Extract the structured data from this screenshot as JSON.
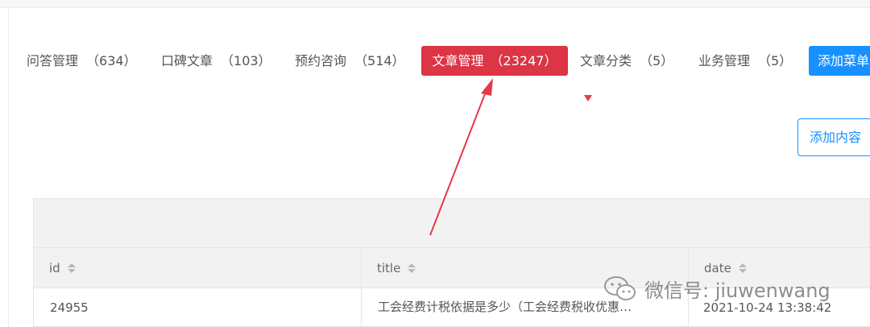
{
  "tabs": [
    {
      "label": "问答管理",
      "count": "（634）"
    },
    {
      "label": "口碑文章",
      "count": "（103）"
    },
    {
      "label": "预约咨询",
      "count": "（514）"
    },
    {
      "label": "文章管理",
      "count": "（23247）"
    },
    {
      "label": "文章分类",
      "count": "（5）"
    },
    {
      "label": "业务管理",
      "count": "（5）"
    },
    {
      "label": "添加菜单",
      "count": ""
    }
  ],
  "add_content_button": "添加内容",
  "table": {
    "columns": [
      "id",
      "title",
      "date"
    ],
    "rows": [
      {
        "id": "24955",
        "title": "工会经费计税依据是多少（工会经费税收优惠…",
        "date": "2021-10-24 13:38:42"
      }
    ]
  },
  "watermark": {
    "text": "微信号: jiuwenwang"
  },
  "colors": {
    "active_tab": "#dc3545",
    "primary": "#1890ff",
    "annotation_arrow": "#e63946"
  }
}
